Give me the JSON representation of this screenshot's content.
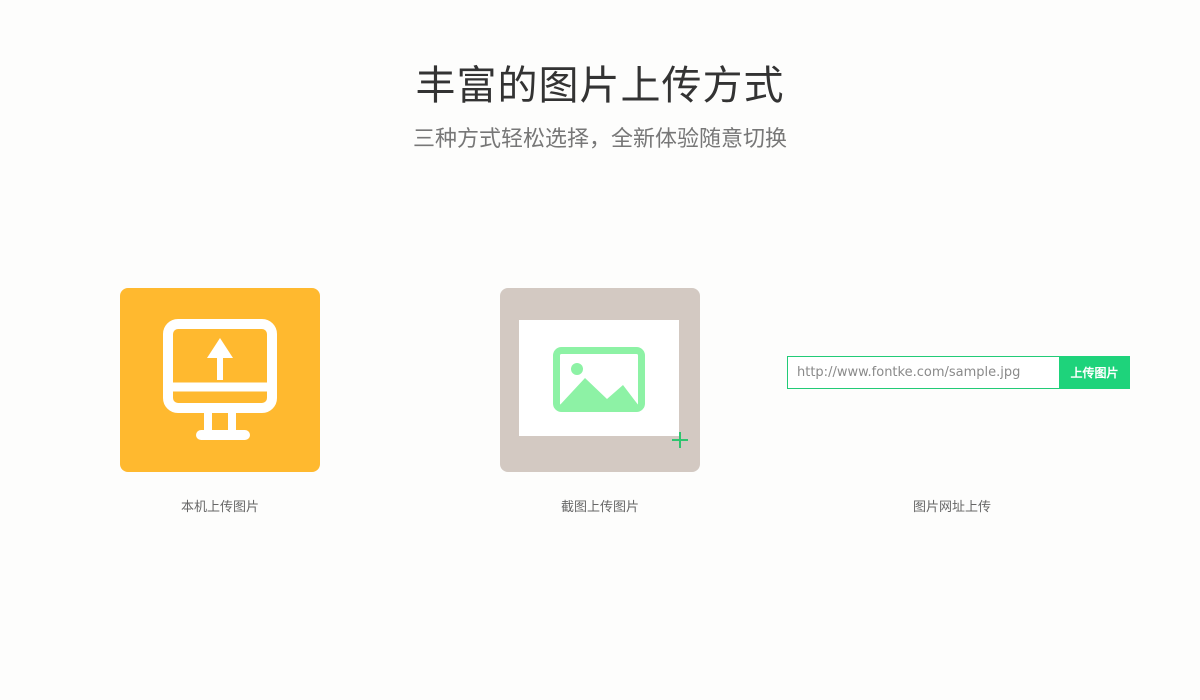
{
  "header": {
    "title": "丰富的图片上传方式",
    "subtitle": "三种方式轻松选择，全新体验随意切换"
  },
  "options": [
    {
      "id": "local",
      "label": "本机上传图片",
      "icon": "monitor-upload-icon",
      "color": "#ffb92f"
    },
    {
      "id": "screenshot",
      "label": "截图上传图片",
      "icon": "image-icon",
      "color": "#d3c9c2",
      "accent": "#8df2a5"
    },
    {
      "id": "url",
      "label": "图片网址上传",
      "input_placeholder": "http://www.fontke.com/sample.jpg",
      "input_value": "",
      "button_label": "上传图片",
      "color": "#1ed37b"
    }
  ]
}
